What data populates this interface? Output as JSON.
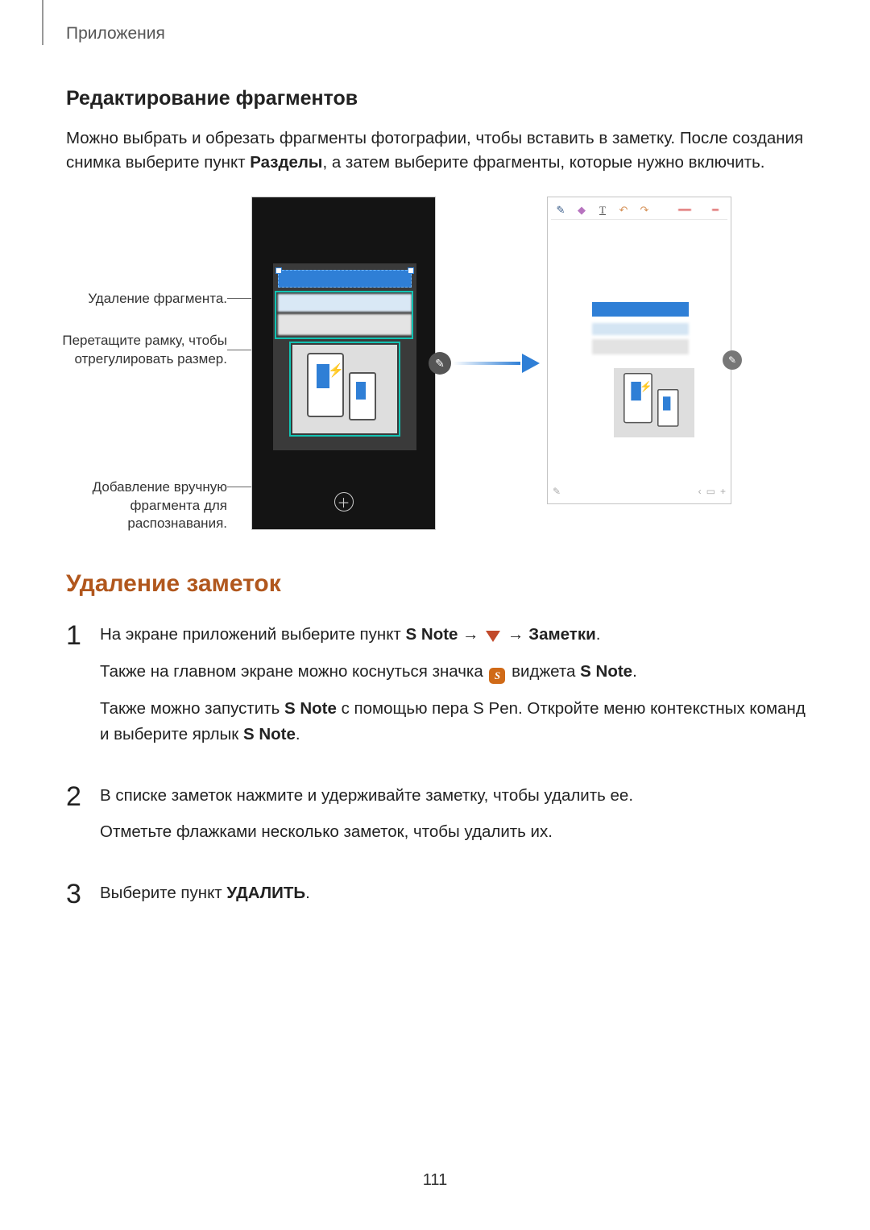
{
  "header": {
    "breadcrumb": "Приложения"
  },
  "section_edit": {
    "title": "Редактирование фрагментов",
    "p1_pre": "Можно выбрать и обрезать фрагменты фотографии, чтобы вставить в заметку. После создания снимка выберите пункт ",
    "p1_bold": "Разделы",
    "p1_post": ", а затем выберите фрагменты, которые нужно включить."
  },
  "callouts": {
    "delete": "Удаление фрагмента.",
    "resize1": "Перетащите рамку, чтобы",
    "resize2": "отрегулировать размер.",
    "add1": "Добавление вручную",
    "add2": "фрагмента для",
    "add3": "распознавания."
  },
  "figure": {
    "plus": "＋",
    "pencil": "✎",
    "toolbar_T": "T",
    "undo": "↶",
    "redo": "↷",
    "pen": "✎",
    "eraser": "◆",
    "chev_left": "‹",
    "chev_right": "›",
    "small_plus": "+",
    "small_pen": "✎"
  },
  "section_delete": {
    "title": "Удаление заметок",
    "step1": {
      "a_pre": "На экране приложений выберите пункт ",
      "a_b1": "S Note",
      "a_arrow1": " → ",
      "a_arrow2": " → ",
      "a_b2": "Заметки",
      "a_post": ".",
      "b_pre": "Также на главном экране можно коснуться значка ",
      "b_post_pre": " виджета ",
      "b_b1": "S Note",
      "b_post": ".",
      "c_pre": "Также можно запустить ",
      "c_b1": "S Note",
      "c_mid": " с помощью пера S Pen. Откройте меню контекстных команд и выберите ярлык ",
      "c_b2": "S Note",
      "c_post": "."
    },
    "step2": {
      "a": "В списке заметок нажмите и удерживайте заметку, чтобы удалить ее.",
      "b": "Отметьте флажками несколько заметок, чтобы удалить их."
    },
    "step3": {
      "pre": "Выберите пункт ",
      "bold": "УДАЛИТЬ",
      "post": "."
    }
  },
  "nums": {
    "n1": "1",
    "n2": "2",
    "n3": "3"
  },
  "page": "111"
}
